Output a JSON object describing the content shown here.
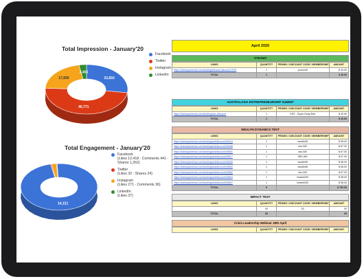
{
  "impression": {
    "title": "Total Impression - January'20",
    "legend": [
      {
        "label": "Facebook",
        "color": "#3b73d7"
      },
      {
        "label": "Twitter",
        "color": "#dc3a17"
      },
      {
        "label": "Instagram",
        "color": "#f5a41c"
      },
      {
        "label": "LinkedIn",
        "color": "#2e8b2e"
      }
    ],
    "slice_labels": [
      "22,816",
      "40,771",
      "17,830",
      "2,455"
    ]
  },
  "engagement": {
    "title": "Total Engagement - January'20",
    "legend": [
      {
        "label": "Facebook",
        "sub": "(Likes 12,418 - Comments 441 - Shares 1,262)",
        "color": "#3b73d7"
      },
      {
        "label": "Twitter",
        "sub": "(Likes 32 - Shares 24)",
        "color": "#dc3a17"
      },
      {
        "label": "Instagram",
        "sub": "(Likes 271 - Comments 36)",
        "color": "#f5a41c"
      },
      {
        "label": "LinkedIn",
        "sub": "(Likes 37)",
        "color": "#2e8b2e"
      }
    ],
    "slice_labels": [
      "14,121"
    ]
  },
  "chart_data": [
    {
      "type": "pie",
      "title": "Total Impression - January'20",
      "categories": [
        "Facebook",
        "Twitter",
        "Instagram",
        "LinkedIn"
      ],
      "values": [
        22816,
        40771,
        17830,
        2455
      ],
      "legend": "right"
    },
    {
      "type": "pie",
      "title": "Total Engagement - January'20",
      "categories": [
        "Facebook",
        "Twitter",
        "Instagram",
        "LinkedIn"
      ],
      "values": [
        14121,
        56,
        307,
        37
      ],
      "legend": "right"
    }
  ],
  "report": {
    "title": "April 2020",
    "columns": [
      "LINKS",
      "QUANTITY",
      "PROMO / DISCOUNT CODE / MEMBERSHIP",
      "AMOUNT"
    ],
    "sections": [
      {
        "name": "STEAMS",
        "color": "#5cb85c",
        "rows": [
          {
            "link": "https://startupamerica.com/landing/steams-discount-2020",
            "qty": "1",
            "code": "promo40",
            "amount": "$ 40.00"
          }
        ],
        "total": {
          "label": "TOTAL",
          "qty": "1",
          "amount": "$ 40.00"
        }
      },
      {
        "name": "AUSTRALASIA ENTREPRENEURSHIP SUMMIT",
        "color": "#3fd3e0",
        "rows": [
          {
            "link": "https://startupamerica.com/landing/aes-discount",
            "qty": "1",
            "code": "ESS - Super Early Bird",
            "amount": "$ 40.50"
          }
        ],
        "total": {
          "label": "TOTAL",
          "qty": "1",
          "amount": "$ 40.50"
        }
      },
      {
        "name": "WEALTH DYNAMICS TEST",
        "color": "#e8b9a6",
        "rows": [
          {
            "link": "https://startupamerica.com/landing/wd/discount/28410",
            "qty": "1",
            "code": "wealth98",
            "amount": "$ 98.00"
          },
          {
            "link": "https://startupamerica.com/landing/wd/discount/28468",
            "qty": "1",
            "code": "sbs-WD",
            "amount": "$ 67.00"
          },
          {
            "link": "https://startupamerica.com/landing/wd/discount/28501",
            "qty": "1",
            "code": "sbs-WD",
            "amount": "$ 67.00"
          },
          {
            "link": "https://startupamerica.com/landing/wd/discount/28517",
            "qty": "1",
            "code": "SBS-WD",
            "amount": "$ 67.00"
          },
          {
            "link": "https://startupamerica.com/landing/wd/discount/28539",
            "qty": "1",
            "code": "wealth98",
            "amount": "$ 98.00"
          },
          {
            "link": "https://startupamerica.com/landing/wd/discount/28560",
            "qty": "1",
            "code": "wealth98",
            "amount": "$ 98.00"
          },
          {
            "link": "https://startupamerica.com/landing/wd/discount/28582",
            "qty": "1",
            "code": "sbs-WD",
            "amount": "$ 67.00"
          },
          {
            "link": "https://startupamerica.com/landing/wd/discount/28603",
            "qty": "1",
            "code": "Instant250",
            "amount": "$ 98.00"
          },
          {
            "link": "https://startupamerica.com/landing/wd/discount/28627",
            "qty": "1",
            "code": "instant250",
            "amount": "$ 98.00"
          }
        ],
        "total": {
          "label": "TOTAL",
          "qty": "9",
          "amount": "$ 752.00"
        }
      },
      {
        "name": "IMPACT TEST",
        "color": "#e8e8e8",
        "rows": [
          {
            "link": "",
            "qty": "00",
            "code": "00",
            "amount": "00"
          }
        ],
        "total": {
          "label": "TOTAL",
          "qty": "00",
          "amount": "00"
        }
      },
      {
        "name": "Crisis Leadership Webinar 28th April",
        "color": "#f2c6a0",
        "rows": [],
        "total": null
      }
    ]
  }
}
